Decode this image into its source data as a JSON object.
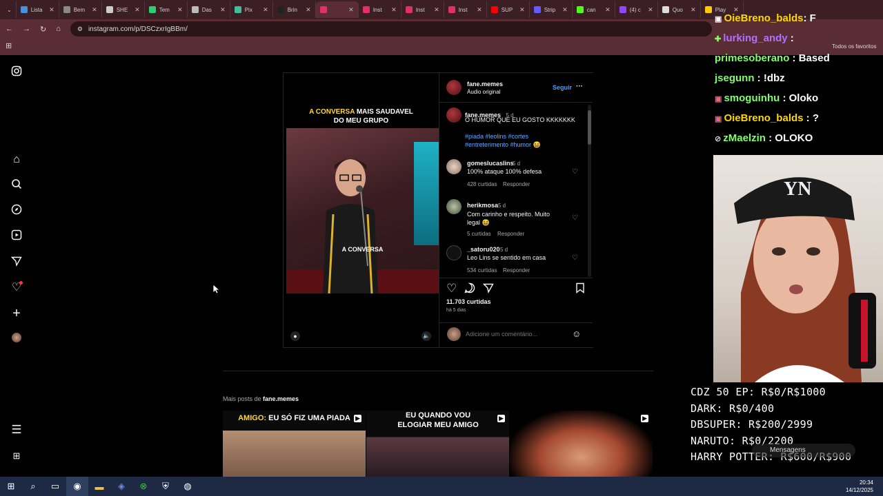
{
  "browser": {
    "tabs": [
      {
        "label": "Lista",
        "color": "#4a90e2"
      },
      {
        "label": "Bem",
        "color": "#888888"
      },
      {
        "label": "SHE",
        "color": "#cccccc"
      },
      {
        "label": "Tem",
        "color": "#2ecc71"
      },
      {
        "label": "Das",
        "color": "#bbbbbb"
      },
      {
        "label": "Pix",
        "color": "#3fbfa0"
      },
      {
        "label": "Brin",
        "color": "#222222"
      },
      {
        "label": "",
        "color": "#e1306c",
        "active": true
      },
      {
        "label": "Inst",
        "color": "#e1306c"
      },
      {
        "label": "Inst",
        "color": "#e1306c"
      },
      {
        "label": "Inst",
        "color": "#e1306c"
      },
      {
        "label": "SUP",
        "color": "#ff0000"
      },
      {
        "label": "Strip",
        "color": "#635bff"
      },
      {
        "label": "can",
        "color": "#53fc18"
      },
      {
        "label": "(4) c",
        "color": "#9146ff"
      },
      {
        "label": "Quo",
        "color": "#dddddd"
      },
      {
        "label": "Play",
        "color": "#ffcc00"
      }
    ],
    "url": "instagram.com/p/DSCzxrIgBBm/",
    "bookmarks_right": "Todos os favoritos"
  },
  "post": {
    "video_caption_line1_highlight": "A CONVERSA",
    "video_caption_line1_rest": " MAIS SAUDAVEL",
    "video_caption_line2": "DO MEU GRUPO",
    "video_subtitle": "A CONVERSA",
    "author": "fane.memes",
    "audio": "Áudio original",
    "follow": "Seguir",
    "more": "···",
    "caption_author": "fane.memes",
    "caption_time": "5 d",
    "caption_text": "O HUMOR QUE EU GOSTO KKKKKKK",
    "hashtags_line1": "#piada #leolins #cortes",
    "hashtags_line2": "#entreterimento #humor 😆",
    "comments": [
      {
        "user": "gomeslucaslins",
        "time": "5 d",
        "text": "100% ataque 100% defesa",
        "likes": "428 curtidas",
        "reply": "Responder"
      },
      {
        "user": "herikmosa",
        "time": "5 d",
        "text": "Com carinho e respeito. Muito legal 😆",
        "likes": "5 curtidas",
        "reply": "Responder"
      },
      {
        "user": "_satoru020",
        "time": "5 d",
        "text": "Leo Lins se sentido em casa",
        "likes": "534 curtidas",
        "reply": "Responder"
      }
    ],
    "likes": "11.703 curtidas",
    "posted": "há 5 dias",
    "comment_placeholder": "Adicione um comentário..."
  },
  "more_posts": {
    "label_prefix": "Mais posts de ",
    "label_user": "fane.memes",
    "thumbs": [
      {
        "text_highlight": "AMIGO:",
        "text": " EU SÓ FIZ UMA PIADA"
      },
      {
        "text_highlight": "",
        "text": "EU QUANDO VOU ELOGIAR MEU AMIGO"
      },
      {
        "text_highlight": "",
        "text": ""
      }
    ]
  },
  "stream": {
    "chat": [
      {
        "user": "OieBreno_balds",
        "msg": ": F",
        "color": "#ffd700"
      },
      {
        "user": "lurking_andy",
        "msg": " :",
        "color": "#b070ff"
      },
      {
        "user": "primesoberano",
        "msg": " : Based",
        "color": "#7fff6a"
      },
      {
        "user": "jsegunn",
        "msg": " : !dbz",
        "color": "#7fff6a"
      },
      {
        "user": "smoguinhu",
        "msg": " : Oloko",
        "color": "#7fff6a"
      },
      {
        "user": "OieBreno_balds",
        "msg": " : ?",
        "color": "#ffd700"
      },
      {
        "user": "zMaelzin",
        "msg": " : OLOKO",
        "color": "#7fff6a"
      }
    ],
    "cap_text": "YN",
    "goals": [
      "CDZ 50 EP: R$0/R$1000",
      "DARK: R$0/400",
      "DBSUPER: R$200/2999",
      "NARUTO: R$0/2200",
      "HARRY POTTER: R$600/R$900"
    ],
    "messages_label": "Mensagens"
  },
  "taskbar": {
    "time": "20:34",
    "date": "14/12/2025"
  }
}
